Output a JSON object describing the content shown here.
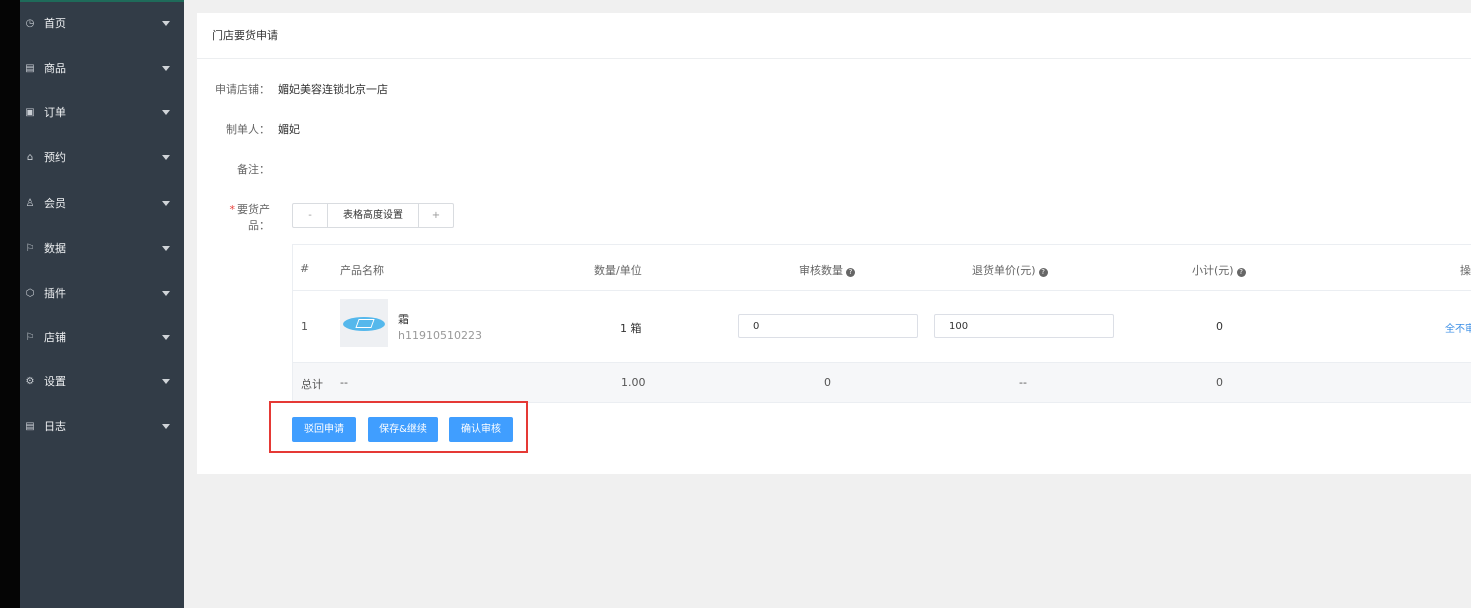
{
  "sidebar": {
    "items": [
      {
        "label": "首页",
        "icon": "dashboard-icon",
        "glyph": "◷"
      },
      {
        "label": "商品",
        "icon": "goods-icon",
        "glyph": "▤"
      },
      {
        "label": "订单",
        "icon": "order-icon",
        "glyph": "▣"
      },
      {
        "label": "预约",
        "icon": "home-icon",
        "glyph": "⌂"
      },
      {
        "label": "会员",
        "icon": "member-icon",
        "glyph": "♙"
      },
      {
        "label": "数据",
        "icon": "flag-icon",
        "glyph": "⚐"
      },
      {
        "label": "插件",
        "icon": "plugin-icon",
        "glyph": "⬡"
      },
      {
        "label": "店铺",
        "icon": "store-flag-icon",
        "glyph": "⚐"
      },
      {
        "label": "设置",
        "icon": "settings-icon",
        "glyph": "⚙"
      },
      {
        "label": "日志",
        "icon": "log-icon",
        "glyph": "▤"
      }
    ]
  },
  "panel": {
    "title": "门店要货申请"
  },
  "form": {
    "store_label": "申请店铺：",
    "store_value": "媚妃美容连锁北京一店",
    "maker_label": "制单人：",
    "maker_value": "媚妃",
    "remark_label": "备注：",
    "products_required": "*",
    "products_label": "要货产品："
  },
  "stepper": {
    "minus": "-",
    "label": "表格高度设置",
    "plus": "+"
  },
  "table": {
    "headers": {
      "index": "#",
      "name": "产品名称",
      "qty_unit": "数量/单位",
      "audit_qty": "审核数量",
      "return_price": "退货单价(元)",
      "subtotal": "小计(元)",
      "partial": "操"
    },
    "help_glyph": "?",
    "row": {
      "index": "1",
      "product_name": "霜",
      "product_code": "h11910510223",
      "qty_unit": "1 箱",
      "audit_qty": "0",
      "return_price": "100",
      "subtotal": "0",
      "action": "全不审"
    },
    "footer": {
      "label": "总计",
      "name": "--",
      "qty": "1.00",
      "audit_qty": "0",
      "return_price": "--",
      "subtotal": "0"
    }
  },
  "actions": {
    "withdraw": "驳回申请",
    "save": "保存&继续",
    "confirm": "确认审核"
  },
  "colors": {
    "sidebar_bg": "#323c47",
    "primary": "#409eff",
    "highlight_border": "#e53935",
    "link": "#3a8ee6"
  }
}
